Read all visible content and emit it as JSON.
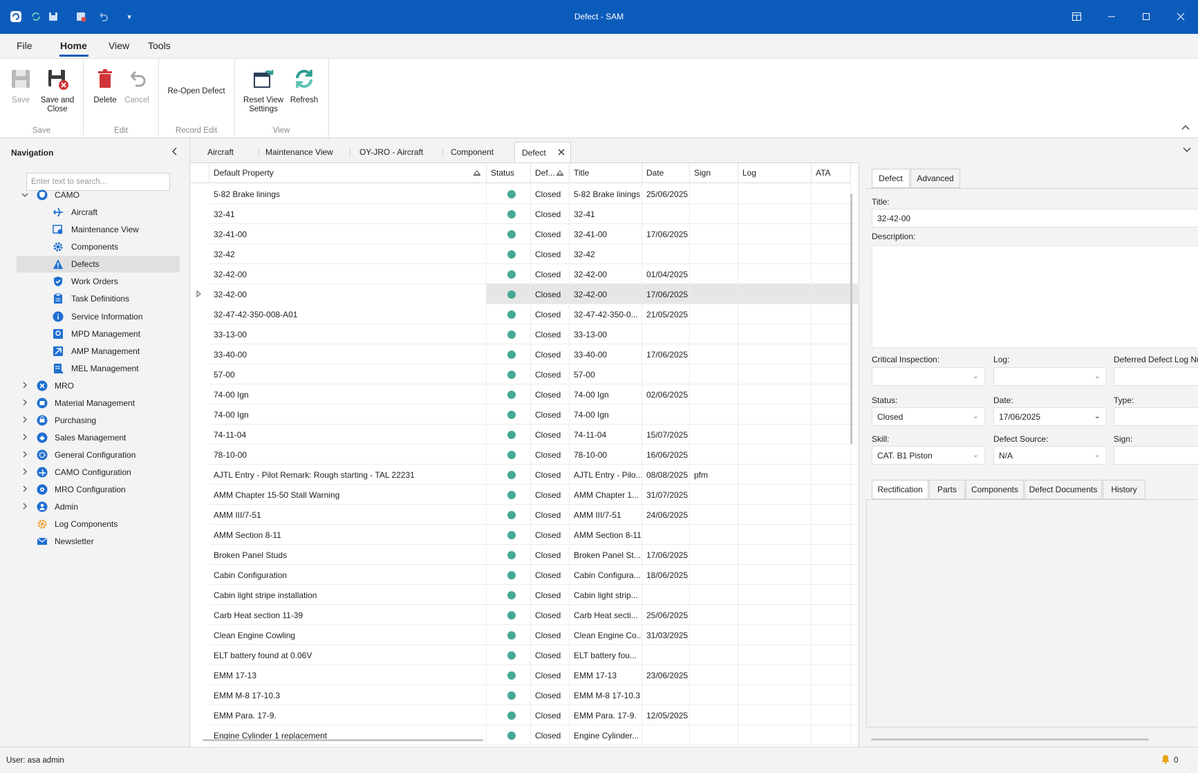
{
  "window": {
    "title": "Defect - SAM"
  },
  "menu": {
    "tabs": [
      "File",
      "Home",
      "View",
      "Tools"
    ],
    "active": "Home"
  },
  "ribbon": {
    "save": "Save",
    "save_close_line1": "Save and",
    "save_close_line2": "Close",
    "delete": "Delete",
    "cancel": "Cancel",
    "reopen": "Re-Open Defect",
    "reset_line1": "Reset View",
    "reset_line2": "Settings",
    "refresh": "Refresh",
    "groups": {
      "save": "Save",
      "edit": "Edit",
      "record_edit": "Record Edit",
      "view": "View"
    }
  },
  "navigation": {
    "title": "Navigation",
    "search_placeholder": "Enter text to search...",
    "items": [
      {
        "label": "CAMO",
        "icon": "camo-shield-icon",
        "expanded": true
      },
      {
        "label": "Aircraft",
        "icon": "airplane-icon"
      },
      {
        "label": "Maintenance View",
        "icon": "maintenance-view-icon"
      },
      {
        "label": "Components",
        "icon": "gear-icon"
      },
      {
        "label": "Defects",
        "icon": "warning-triangle-icon",
        "selected": true
      },
      {
        "label": "Work Orders",
        "icon": "work-order-shield-icon"
      },
      {
        "label": "Task Definitions",
        "icon": "clipboard-icon"
      },
      {
        "label": "Service Information",
        "icon": "info-icon"
      },
      {
        "label": "MPD Management",
        "icon": "mpd-icon"
      },
      {
        "label": "AMP Management",
        "icon": "amp-icon"
      },
      {
        "label": "MEL Management",
        "icon": "mel-icon"
      },
      {
        "label": "MRO",
        "icon": "mro-icon"
      },
      {
        "label": "Material Management",
        "icon": "material-icon"
      },
      {
        "label": "Purchasing",
        "icon": "purchasing-icon"
      },
      {
        "label": "Sales Management",
        "icon": "sales-icon"
      },
      {
        "label": "General Configuration",
        "icon": "settings-icon"
      },
      {
        "label": "CAMO Configuration",
        "icon": "camo-config-icon"
      },
      {
        "label": "MRO Configuration",
        "icon": "mro-config-icon"
      },
      {
        "label": "Admin",
        "icon": "admin-user-icon"
      },
      {
        "label": "Log Components",
        "icon": "log-components-icon"
      },
      {
        "label": "Newsletter",
        "icon": "newsletter-icon"
      }
    ]
  },
  "doc_tabs": [
    "Aircraft",
    "Maintenance View",
    "OY-JRO - Aircraft",
    "Component",
    "Defect"
  ],
  "grid": {
    "columns": [
      "Default Property",
      "Status",
      "Def...",
      "Title",
      "Date",
      "Sign",
      "Log",
      "ATA"
    ],
    "rows": [
      {
        "prop": "5-82 Brake linings",
        "state": "Closed",
        "title": "5-82 Brake linings",
        "date": "25/06/2025",
        "sign": ""
      },
      {
        "prop": "32-41",
        "state": "Closed",
        "title": "32-41",
        "date": "",
        "sign": ""
      },
      {
        "prop": "32-41-00",
        "state": "Closed",
        "title": "32-41-00",
        "date": "17/06/2025",
        "sign": ""
      },
      {
        "prop": "32-42",
        "state": "Closed",
        "title": "32-42",
        "date": "",
        "sign": ""
      },
      {
        "prop": "32-42-00",
        "state": "Closed",
        "title": "32-42-00",
        "date": "01/04/2025",
        "sign": ""
      },
      {
        "prop": "32-42-00",
        "state": "Closed",
        "title": "32-42-00",
        "date": "17/06/2025",
        "sign": "",
        "selected": true
      },
      {
        "prop": "32-47-42-350-008-A01",
        "state": "Closed",
        "title": "32-47-42-350-0...",
        "date": "21/05/2025",
        "sign": ""
      },
      {
        "prop": "33-13-00",
        "state": "Closed",
        "title": "33-13-00",
        "date": "",
        "sign": ""
      },
      {
        "prop": "33-40-00",
        "state": "Closed",
        "title": "33-40-00",
        "date": "17/06/2025",
        "sign": ""
      },
      {
        "prop": "57-00",
        "state": "Closed",
        "title": "57-00",
        "date": "",
        "sign": ""
      },
      {
        "prop": "74-00 Ign",
        "state": "Closed",
        "title": "74-00 Ign",
        "date": "02/06/2025",
        "sign": ""
      },
      {
        "prop": "74-00 Ign",
        "state": "Closed",
        "title": "74-00 Ign",
        "date": "",
        "sign": ""
      },
      {
        "prop": "74-11-04",
        "state": "Closed",
        "title": "74-11-04",
        "date": "15/07/2025",
        "sign": ""
      },
      {
        "prop": "78-10-00",
        "state": "Closed",
        "title": "78-10-00",
        "date": "16/06/2025",
        "sign": ""
      },
      {
        "prop": "AJTL Entry - Pilot Remark: Rough starting - TAL 22231",
        "state": "Closed",
        "title": "AJTL Entry - Pilo...",
        "date": "08/08/2025",
        "sign": "pfm"
      },
      {
        "prop": "AMM Chapter 15-50 Stall Warning",
        "state": "Closed",
        "title": "AMM Chapter 1...",
        "date": "31/07/2025",
        "sign": ""
      },
      {
        "prop": "AMM III/7-51",
        "state": "Closed",
        "title": "AMM III/7-51",
        "date": "24/06/2025",
        "sign": ""
      },
      {
        "prop": "AMM Section 8-11",
        "state": "Closed",
        "title": "AMM Section 8-11",
        "date": "",
        "sign": ""
      },
      {
        "prop": "Broken Panel Studs",
        "state": "Closed",
        "title": "Broken Panel St...",
        "date": "17/06/2025",
        "sign": ""
      },
      {
        "prop": "Cabin Configuration",
        "state": "Closed",
        "title": "Cabin Configura...",
        "date": "18/06/2025",
        "sign": ""
      },
      {
        "prop": "Cabin light stripe installation",
        "state": "Closed",
        "title": "Cabin light strip...",
        "date": "",
        "sign": ""
      },
      {
        "prop": "Carb Heat section 11-39",
        "state": "Closed",
        "title": "Carb Heat secti...",
        "date": "25/06/2025",
        "sign": ""
      },
      {
        "prop": "Clean Engine Cowling",
        "state": "Closed",
        "title": "Clean Engine Co...",
        "date": "31/03/2025",
        "sign": ""
      },
      {
        "prop": "ELT battery found at 0.06V",
        "state": "Closed",
        "title": "ELT battery fou...",
        "date": "",
        "sign": ""
      },
      {
        "prop": "EMM 17-13",
        "state": "Closed",
        "title": "EMM 17-13",
        "date": "23/06/2025",
        "sign": ""
      },
      {
        "prop": "EMM M-8 17-10.3",
        "state": "Closed",
        "title": "EMM M-8 17-10.3",
        "date": "",
        "sign": ""
      },
      {
        "prop": "EMM Para. 17-9.",
        "state": "Closed",
        "title": "EMM Para. 17-9.",
        "date": "12/05/2025",
        "sign": ""
      },
      {
        "prop": "Engine Cylinder 1 replacement",
        "state": "Closed",
        "title": "Engine Cylinder...",
        "date": "",
        "sign": ""
      }
    ]
  },
  "detail": {
    "tabs": [
      "Defect",
      "Advanced"
    ],
    "title_label": "Title:",
    "title_value": "32-42-00",
    "description_label": "Description:",
    "critical_label": "Critical Inspection:",
    "log_label": "Log:",
    "deferred_label": "Deferred Defect Log Num",
    "status_label": "Status:",
    "status_value": "Closed",
    "date_label": "Date:",
    "date_value": "17/06/2025",
    "type_label": "Type:",
    "skill_label": "Skill:",
    "skill_value": "CAT. B1 Piston",
    "source_label": "Defect Source:",
    "source_value": "N/A",
    "sign_label": "Sign:",
    "sub_tabs": [
      "Rectification",
      "Parts",
      "Components",
      "Defect Documents",
      "History"
    ]
  },
  "status": {
    "user": "User: asa admin",
    "notifications": "0"
  },
  "colors": {
    "titlebar": "#0b5cba",
    "status_dot": "#45a995",
    "delete_red": "#d13438",
    "refresh_teal": "#2a9d8f"
  }
}
